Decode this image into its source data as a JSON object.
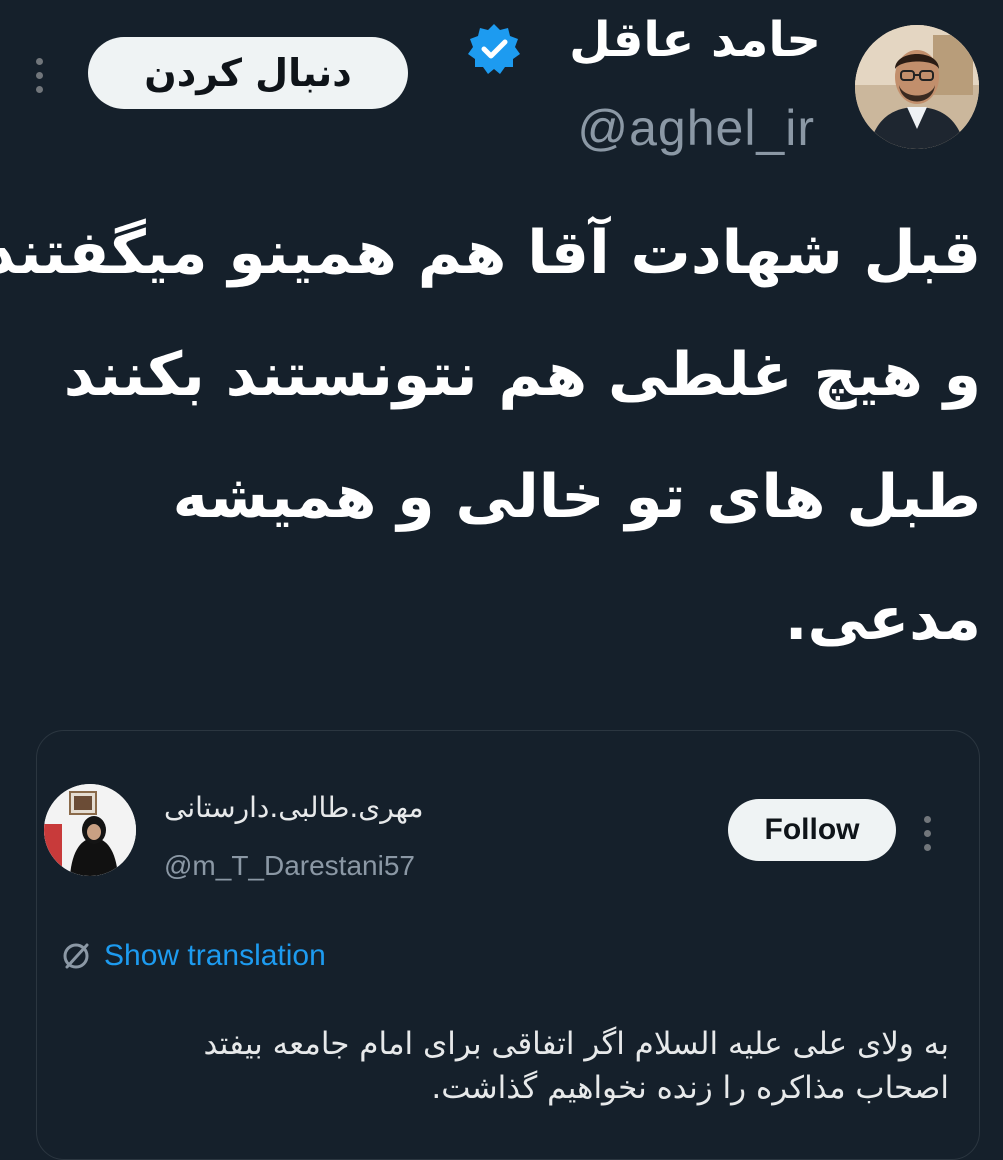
{
  "author": {
    "display_name": "حامد عاقل",
    "handle": "@aghel_ir",
    "follow_label": "دنبال کردن"
  },
  "tweet": {
    "lines": [
      "قبل شهادت آقا هم همینو میگفتند",
      "و هیچ غلطی هم نتونستند بکنند",
      "طبل های تو خالی و همیشه",
      "مدعی."
    ]
  },
  "quoted": {
    "display_name": "مهری.طالبی.دارستانی",
    "handle": "@m_T_Darestani57",
    "follow_label": "Follow",
    "translation_label": "Show translation",
    "lines": [
      "به ولای علی علیه السلام اگر اتفاقی برای امام جامعه بیفتد",
      "اصحاب مذاکره را زنده نخواهیم گذاشت."
    ]
  },
  "colors": {
    "background": "#15202b",
    "accent": "#1d9bf0",
    "secondary_text": "#8b98a5"
  }
}
